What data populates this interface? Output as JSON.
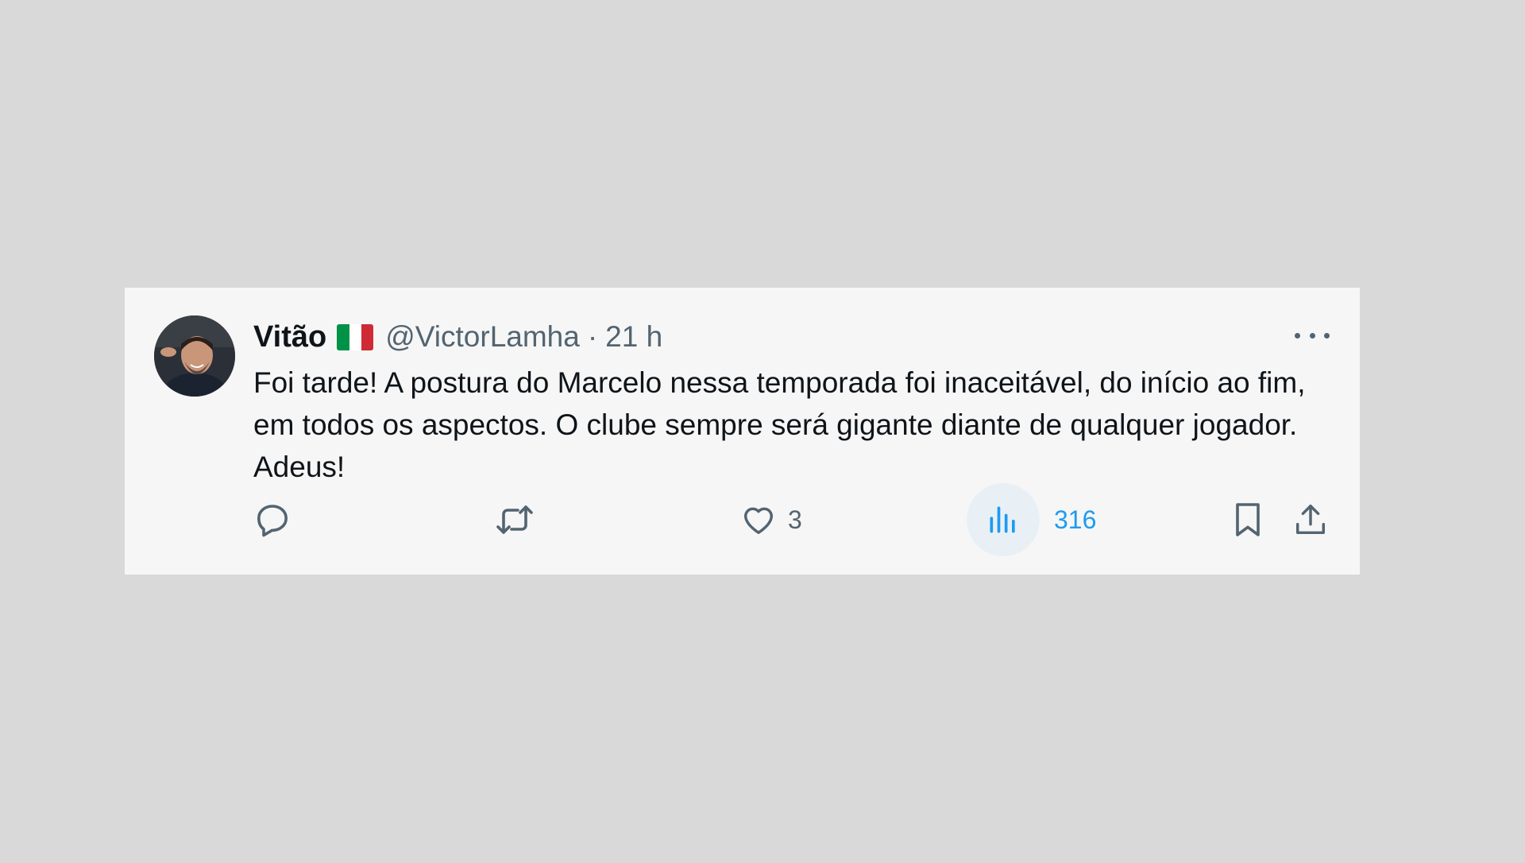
{
  "tweet": {
    "display_name": "Vitão",
    "flag_icon": "italy-flag-icon",
    "flag_colors": [
      "#009246",
      "#ffffff",
      "#ce2b37"
    ],
    "handle": "@VictorLamha",
    "separator": "·",
    "time": "21 h",
    "text": "Foi tarde! A postura do Marcelo nessa temporada foi inaceitável, do início ao fim, em todos os aspectos. O clube sempre será gigante diante de qualquer jogador. Adeus!"
  },
  "actions": {
    "reply_icon": "reply-icon",
    "retweet_icon": "retweet-icon",
    "like_icon": "heart-icon",
    "like_count": "3",
    "views_icon": "views-icon",
    "views_count": "316",
    "bookmark_icon": "bookmark-icon",
    "share_icon": "share-icon"
  },
  "colors": {
    "background": "#d9d9d9",
    "card": "#f6f6f6",
    "text": "#0f1419",
    "muted": "#536471",
    "accent": "#1d9bf0"
  }
}
